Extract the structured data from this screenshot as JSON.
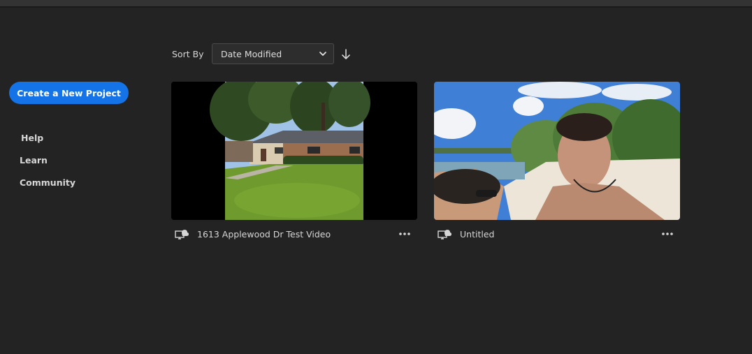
{
  "sidebar": {
    "create_button": "Create a New Project",
    "nav": [
      "Help",
      "Learn",
      "Community"
    ]
  },
  "sort": {
    "label": "Sort By",
    "selected": "Date Modified"
  },
  "projects": [
    {
      "title": "1613 Applewood Dr Test Video",
      "status_icon": "cloud-computer-icon"
    },
    {
      "title": "Untitled",
      "status_icon": "cloud-computer-icon"
    }
  ],
  "colors": {
    "background": "#232323",
    "accent": "#1473e6",
    "text": "#d6d6d6"
  }
}
